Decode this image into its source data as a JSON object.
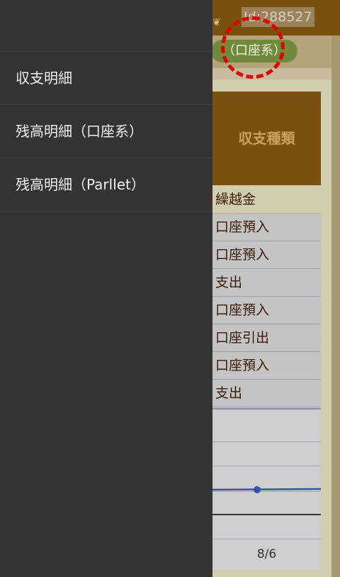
{
  "drawer": {
    "items": [
      {
        "label": "収支明細"
      },
      {
        "label": "残高明細（口座系）"
      },
      {
        "label": "残高明細（Parllet）"
      }
    ]
  },
  "header": {
    "logo": "❦",
    "id_text": "Id:288527",
    "account_pill": "（口座系）"
  },
  "table": {
    "column_header": "収支種類",
    "rows": [
      "繰越金",
      "口座預入",
      "口座預入",
      "支出",
      "口座預入",
      "口座引出",
      "口座預入",
      "支出"
    ]
  },
  "chart_data": {
    "type": "line",
    "x": [
      "8/6"
    ],
    "series": [
      {
        "values": [
          1
        ]
      }
    ],
    "xlabel": "",
    "ylabel": ""
  },
  "colors": {
    "drawer_bg": "#333333",
    "topbar_brown": "#7a500f",
    "pill_green": "#6f8a3c",
    "highlight_ring": "#e00000",
    "chart_line": "#2e56a8"
  }
}
